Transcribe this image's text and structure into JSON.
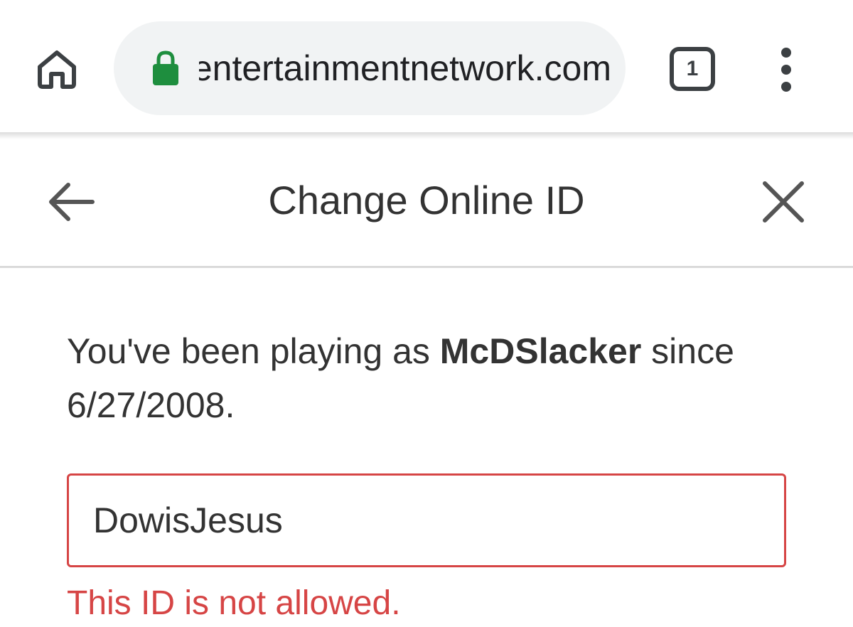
{
  "browser": {
    "url": "entertainmentnetwork.com",
    "tab_count": "1",
    "icons": {
      "home": "home-icon",
      "lock": "lock-icon",
      "tabs": "tab-switcher-icon",
      "menu": "more-vert-icon"
    },
    "colors": {
      "lock": "#1e8e3e",
      "url_bar": "#f1f3f4"
    }
  },
  "dialog": {
    "title": "Change Online ID",
    "icons": {
      "back": "arrow-back-icon",
      "close": "close-icon"
    },
    "intro": {
      "prefix": "You've been playing as ",
      "current_id": "McDSlacker",
      "middle": " since ",
      "date": "6/27/2008",
      "suffix": "."
    },
    "online_id_field": {
      "value": "DowisJesus",
      "placeholder": ""
    },
    "error_message": "This ID is not allowed.",
    "colors": {
      "error": "#d64545",
      "text": "#333333"
    }
  }
}
